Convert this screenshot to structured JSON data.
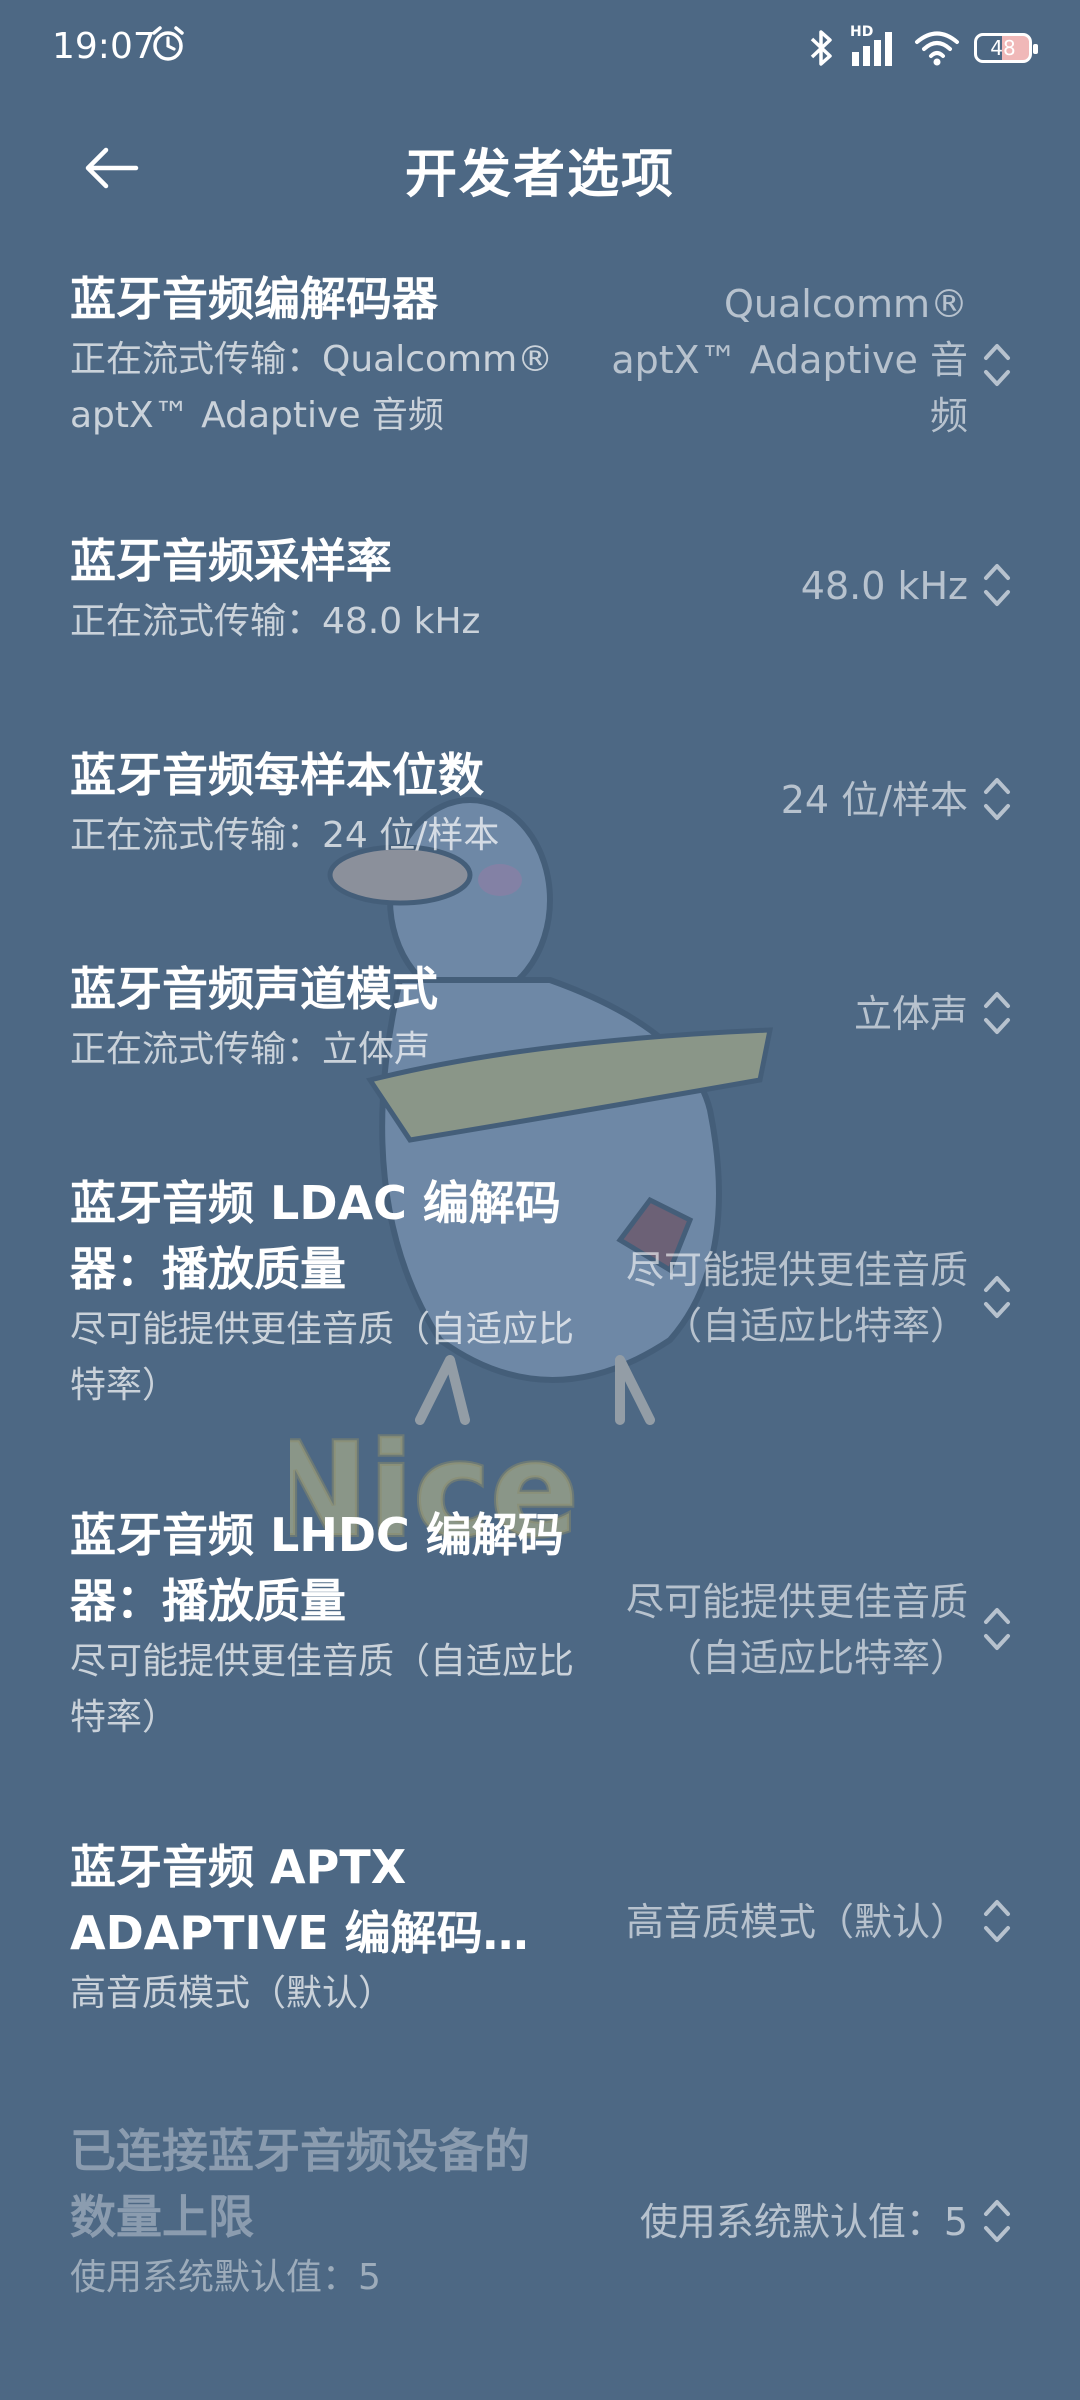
{
  "status_bar": {
    "time": "19:07",
    "alarm_icon": "alarm-clock-icon",
    "bluetooth_icon": "bluetooth-icon",
    "signal_label": "HD",
    "signal_icon": "cellular-signal-icon",
    "wifi_icon": "wifi-icon",
    "battery_level": "48"
  },
  "header": {
    "back_icon": "arrow-left-icon",
    "title": "开发者选项"
  },
  "settings": [
    {
      "title": "蓝牙音频编解码器",
      "summary": "正在流式传输：Qualcomm® aptX™ Adaptive 音频",
      "value": "Qualcomm® aptX™ Adaptive 音频"
    },
    {
      "title": "蓝牙音频采样率",
      "summary": "正在流式传输：48.0 kHz",
      "value": "48.0 kHz"
    },
    {
      "title": "蓝牙音频每样本位数",
      "summary": "正在流式传输：24 位/样本",
      "value": "24 位/样本"
    },
    {
      "title": "蓝牙音频声道模式",
      "summary": "正在流式传输：立体声",
      "value": "立体声"
    },
    {
      "title": "蓝牙音频 LDAC 编解码器：播放质量",
      "summary": "尽可能提供更佳音质（自适应比特率）",
      "value": "尽可能提供更佳音质（自适应比特率）"
    },
    {
      "title": "蓝牙音频 LHDC 编解码器：播放质量",
      "summary": "尽可能提供更佳音质（自适应比特率）",
      "value": "尽可能提供更佳音质（自适应比特率）"
    },
    {
      "title": "蓝牙音频 APTX ADAPTIVE 编解码…",
      "summary": "高音质模式（默认）",
      "value": "高音质模式（默认）"
    },
    {
      "title": "已连接蓝牙音频设备的数量上限",
      "summary": "使用系统默认值：5",
      "value": "使用系统默认值：5"
    }
  ],
  "chevron_icon": "chevron-up-down-icon",
  "sticker": {
    "text": "Nice",
    "icon": "goose-sticker-icon"
  }
}
